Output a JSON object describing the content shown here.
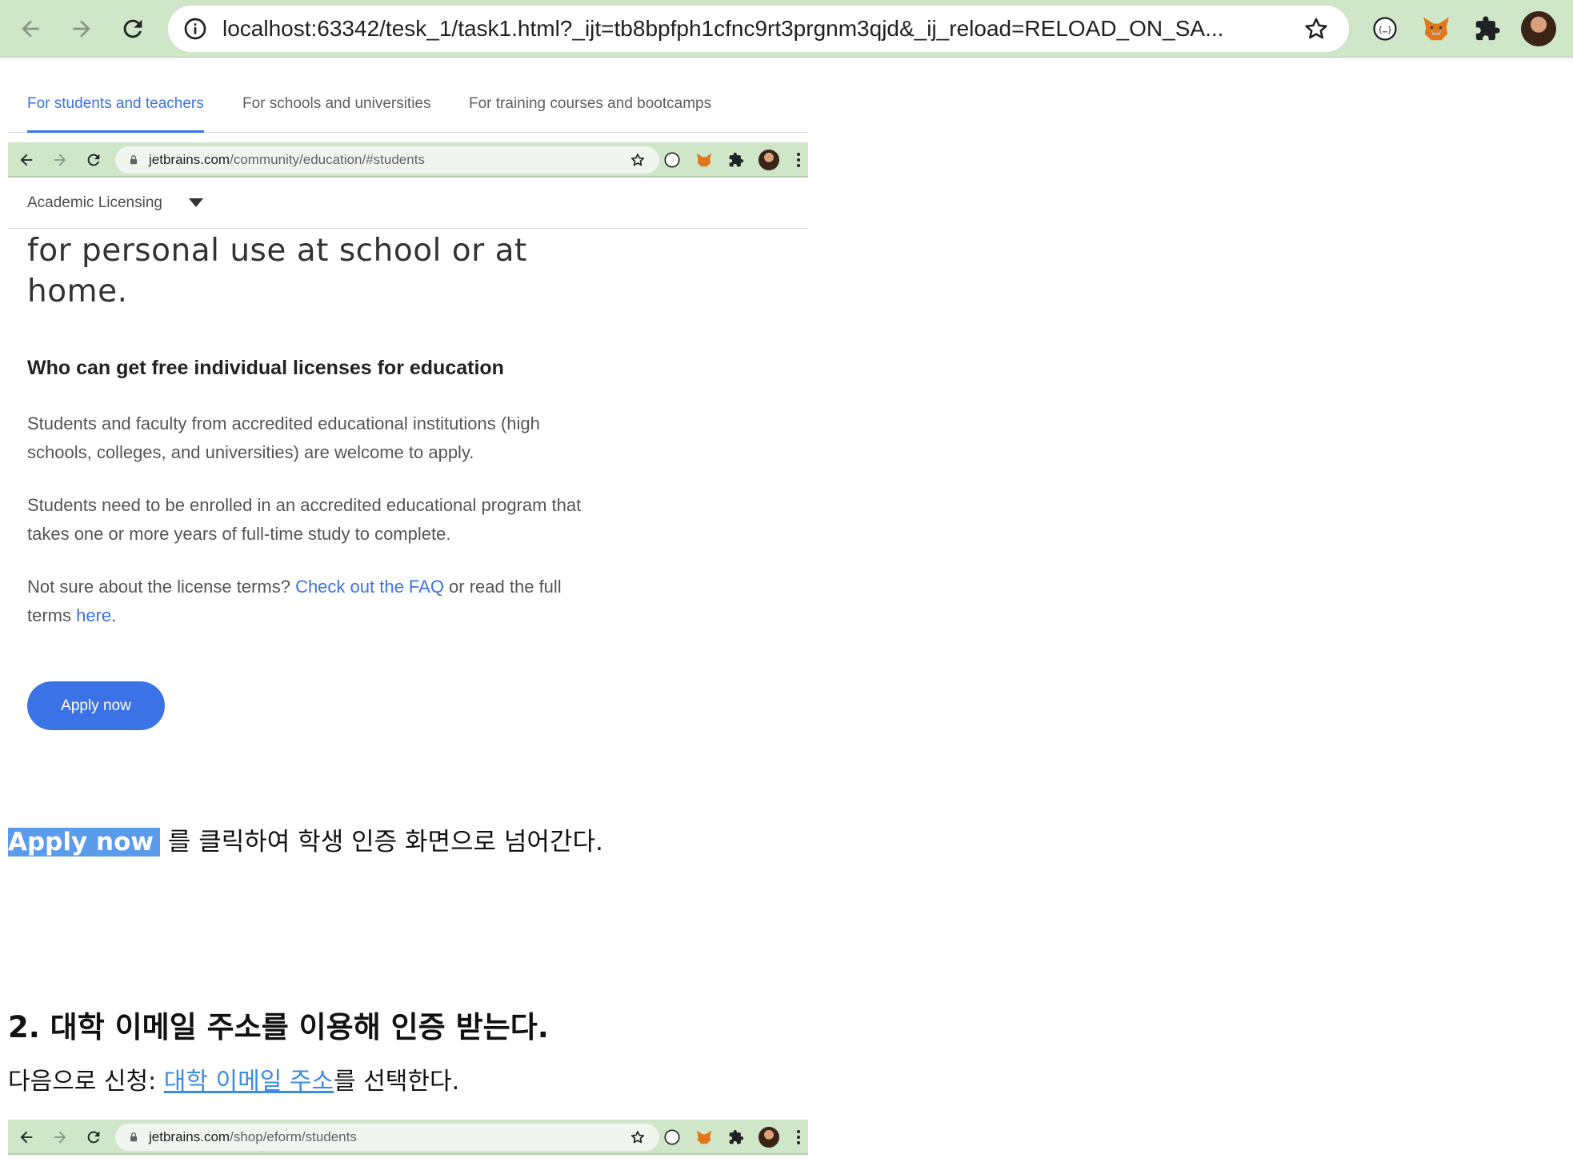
{
  "browser": {
    "url": "localhost:63342/tesk_1/task1.html?_ijt=tb8bpfph1cfnc9rt3prgnm3qjd&_ij_reload=RELOAD_ON_SA...",
    "icons": {
      "back": "arrow-left-icon",
      "forward": "arrow-right-icon",
      "reload": "reload-icon",
      "info": "info-icon",
      "bookmark": "star-icon",
      "extensions": [
        "json-viewer-icon",
        "metamask-fox-icon",
        "puzzle-icon",
        "profile-avatar"
      ]
    },
    "colors": {
      "toolbar": "#cfe6c9",
      "accent": "#3b73e6"
    }
  },
  "screenshot_1": {
    "tabs": [
      {
        "label": "For students and teachers",
        "active": true
      },
      {
        "label": "For schools and universities",
        "active": false
      },
      {
        "label": "For training courses and bootcamps",
        "active": false
      }
    ],
    "inner_browser": {
      "url_host": "jetbrains.com",
      "url_path": "/community/education/#students"
    },
    "licensing_label": "Academic Licensing",
    "hero_line1": "for personal use at school or at",
    "hero_line2": "home.",
    "heading": "Who can get free individual licenses for education",
    "para1": "Students and faculty from accredited educational institutions (high schools, colleges, and universities) are welcome to apply.",
    "para2": "Students need to be enrolled in an accredited educational program that takes one or more years of full-time study to complete.",
    "para3_prefix": "Not sure about the license terms? ",
    "para3_link": "Check out the FAQ",
    "para3_middle": " or read the full terms ",
    "para3_link2": "here",
    "para3_suffix": ".",
    "apply_button": "Apply now"
  },
  "doc": {
    "sentence_highlight": "Apply now",
    "sentence_rest": " 를 클릭하여 학생 인증 화면으로 넘어간다.",
    "section_heading": "2. 대학 이메일 주소를 이용해 인증 받는다.",
    "step_prefix": "다음으로 신청: ",
    "step_link": "대학 이메일 주소",
    "step_suffix": "를 선택한다."
  },
  "screenshot_2": {
    "inner_browser": {
      "url_host": "jetbrains.com",
      "url_path": "/shop/eform/students"
    }
  }
}
